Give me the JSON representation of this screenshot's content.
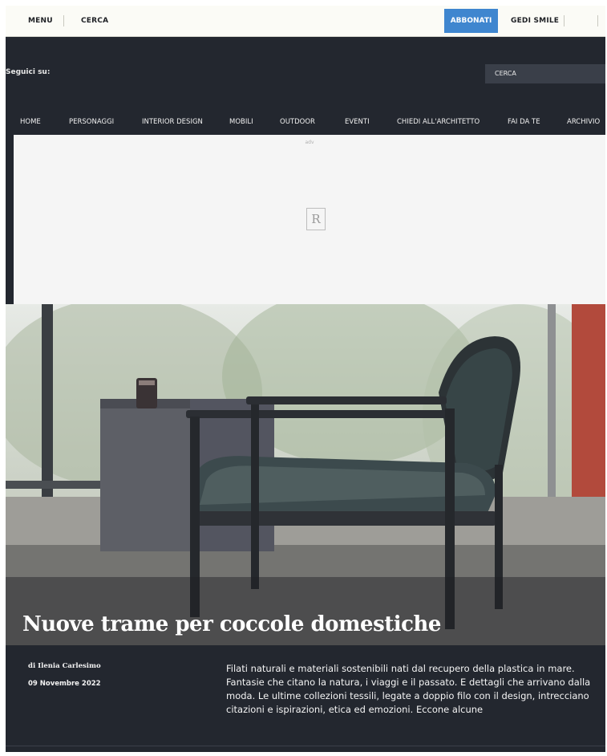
{
  "topbar": {
    "menu_label": "MENU",
    "search_label": "CERCA",
    "subscribe_label": "ABBONATI",
    "smile_label": "GEDI SMILE"
  },
  "header": {
    "follow_label": "Seguici su:",
    "search_placeholder": "CERCA"
  },
  "nav": {
    "items": [
      "HOME",
      "PERSONAGGI",
      "INTERIOR DESIGN",
      "MOBILI",
      "OUTDOOR",
      "EVENTI",
      "CHIEDI ALL'ARCHITETTO",
      "FAI DA TE",
      "ARCHIVIO"
    ]
  },
  "ad": {
    "label": "adv",
    "logo_letter": "R"
  },
  "article": {
    "title": "Nuove trame per coccole domestiche",
    "author": "di Ilenia Carlesimo",
    "date": "09 Novembre 2022",
    "summary": "Filati naturali e materiali sostenibili nati dal recupero della plastica in mare. Fantasie che citano la natura, i viaggi e il passato. E dettagli che arrivano dalla moda. Le ultime collezioni tessili, legate a doppio filo con il design, intrecciano citazioni e ispirazioni, etica ed emozioni. Eccone alcune"
  },
  "colors": {
    "header_bg": "#23272f",
    "topbar_bg": "#fbfbf6",
    "accent": "#3f86cf"
  }
}
